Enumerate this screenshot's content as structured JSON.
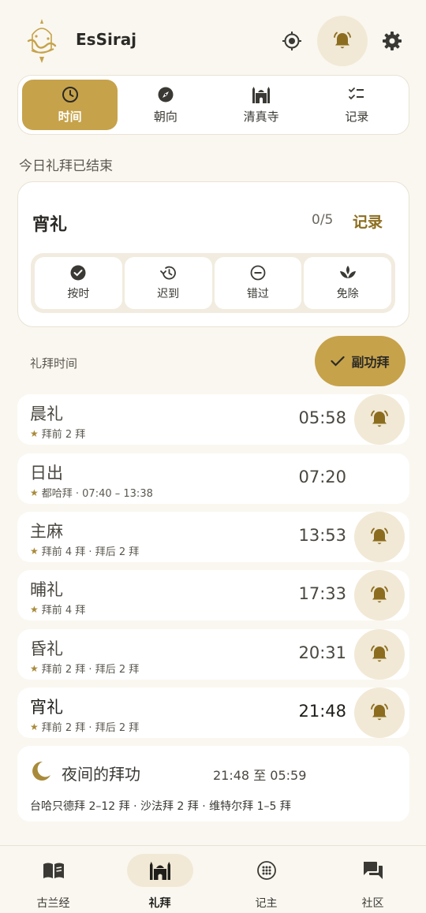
{
  "app": {
    "title": "EsSiraj"
  },
  "colors": {
    "accent": "#C6A24A",
    "accent_soft": "#F1E9D6",
    "accent_text": "#8C6D1F",
    "background": "#FAF7F0"
  },
  "tabs": [
    {
      "label": "时间",
      "icon": "clock-icon",
      "active": true
    },
    {
      "label": "朝向",
      "icon": "compass-icon",
      "active": false
    },
    {
      "label": "清真寺",
      "icon": "mosque-icon",
      "active": false
    },
    {
      "label": "记录",
      "icon": "checklist-icon",
      "active": false
    }
  ],
  "status_heading": "今日礼拜已结束",
  "current": {
    "name": "宵礼",
    "count": "0/5",
    "record_label": "记录",
    "options": [
      {
        "label": "按时",
        "icon": "check-circle-icon"
      },
      {
        "label": "迟到",
        "icon": "history-icon"
      },
      {
        "label": "错过",
        "icon": "minus-circle-icon"
      },
      {
        "label": "免除",
        "icon": "lotus-icon"
      }
    ]
  },
  "times_label": "礼拜时间",
  "sunnah_label": "副功拜",
  "prayers": [
    {
      "name": "晨礼",
      "sub": "拜前 2 拜",
      "time": "05:58",
      "bell": true
    },
    {
      "name": "日出",
      "sub": "都哈拜 · 07:40 – 13:38",
      "time": "07:20",
      "bell": false
    },
    {
      "name": "主麻",
      "sub": "拜前 4 拜 · 拜后 2 拜",
      "time": "13:53",
      "bell": true
    },
    {
      "name": "晡礼",
      "sub": "拜前 4 拜",
      "time": "17:33",
      "bell": true
    },
    {
      "name": "昏礼",
      "sub": "拜前 2 拜 · 拜后 2 拜",
      "time": "20:31",
      "bell": true
    },
    {
      "name": "宵礼",
      "sub": "拜前 2 拜 · 拜后 2 拜",
      "time": "21:48",
      "bell": true
    }
  ],
  "night": {
    "title": "夜间的拜功",
    "range": "21:48 至 05:59",
    "detail": "台哈只德拜 2–12 拜 · 沙法拜 2 拜 · 维特尔拜 1–5 拜"
  },
  "bottom_nav": [
    {
      "label": "古兰经",
      "icon": "book-icon",
      "active": false
    },
    {
      "label": "礼拜",
      "icon": "mosque-icon",
      "active": true
    },
    {
      "label": "记主",
      "icon": "tasbih-icon",
      "active": false
    },
    {
      "label": "社区",
      "icon": "chat-icon",
      "active": false
    }
  ]
}
